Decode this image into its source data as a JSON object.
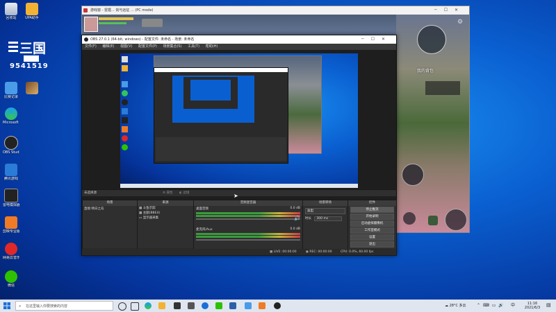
{
  "desktop": {
    "logo": {
      "digits": "9541519"
    },
    "icons": [
      {
        "label": "回收站"
      },
      {
        "label": "UPA助手"
      },
      {
        "label": "比赛记录"
      },
      {
        "label": "Microsoft Edge"
      },
      {
        "label": "OBS Studio"
      },
      {
        "label": "腾讯游戏"
      },
      {
        "label": "雷电模拟器"
      },
      {
        "label": "剪映专业版"
      },
      {
        "label": "网易云音乐"
      },
      {
        "label": "微信"
      }
    ]
  },
  "game_window": {
    "title": "游戏窗 - 雷霆... 剑与远征 ... (PC mode)",
    "player_label": "我的背包",
    "controls": [
      "─",
      "☐",
      "✕"
    ]
  },
  "obs": {
    "title": "OBS 27.0.1 (64-bit, windows) - 配置文件: 未命名 - 场景: 未命名",
    "menu": [
      "文件(F)",
      "编辑(E)",
      "视图(V)",
      "配置文件(P)",
      "场景集合(S)",
      "工具(T)",
      "帮助(H)"
    ],
    "no_source_label": "未选择源",
    "tabs": [
      "属性",
      "滤镜"
    ],
    "panels": {
      "scenes": {
        "title": "场景",
        "items": [
          "直接:晴日之岛"
        ]
      },
      "sources": {
        "title": "来源",
        "items": [
          "斗鱼示踪",
          "主题(BBE4)",
          "显示器采集"
        ]
      },
      "mixer": {
        "title": "音频混音器",
        "channels": [
          {
            "name": "桌面音频",
            "db": "0.0 dB"
          },
          {
            "name": "麦克风/Aux",
            "db": "0.0 dB"
          }
        ]
      },
      "transitions": {
        "title": "场景转场",
        "type": "淡出",
        "duration_label": "时长",
        "duration_value": "300 ms"
      },
      "controls": {
        "title": "控件",
        "buttons": [
          "停止推流",
          "开始录制",
          "启动虚拟摄像机",
          "工作室模式",
          "设置",
          "退出"
        ]
      }
    },
    "status": {
      "live": "LIVE: 00:00:00",
      "rec": "REC: 00:00:00",
      "cpu": "CPU: 0.0%, 60.00 fps"
    }
  },
  "taskbar": {
    "search_placeholder": "在这里输入你要搜索的内容",
    "weather": "28°C 多云",
    "time": "11:16",
    "date": "2021/6/3",
    "lang": "中"
  }
}
